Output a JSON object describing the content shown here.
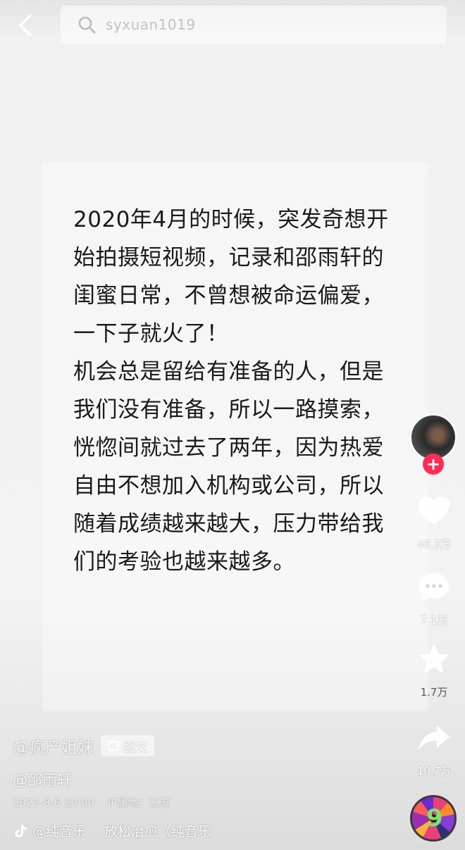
{
  "search": {
    "query": "syxuan1019"
  },
  "post": {
    "paragraphs": [
      "2020年4月的时候，突发奇想开始拍摄短视频，记录和邵雨轩的闺蜜日常，不曾想被命运偏爱，一下子就火了！",
      "机会总是留给有准备的人，但是我们没有准备，所以一路摸索，恍惚间就过去了两年，因为热爱自由不想加入机构或公司，所以随着成绩越来越大，压力带给我们的考验也越来越多。"
    ]
  },
  "actions": {
    "likes": "46.3万",
    "comments": "7.1万",
    "favorites": "1.7万",
    "shares": "10.7万"
  },
  "author": {
    "name": "@疯产姐妹",
    "tag": "图文",
    "mention": "@邵雨轩",
    "date": "2022-8-6 20:00",
    "ip_label": "IP属地：江苏"
  },
  "music": {
    "artist": "@纯音乐",
    "title": "放松治愈（纯音乐"
  },
  "colors": {
    "follow_badge": "#fe2c55",
    "text": "#1a1a1a"
  }
}
